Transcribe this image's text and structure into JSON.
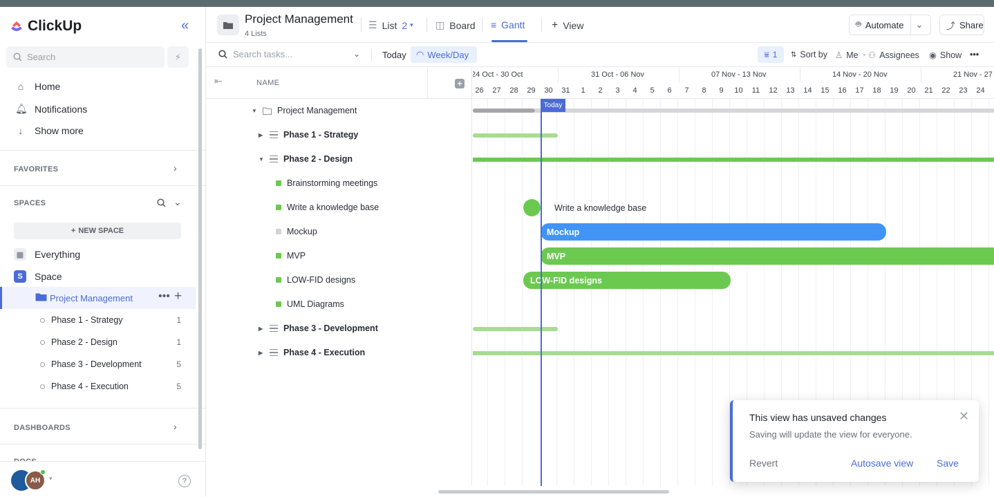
{
  "app": {
    "name": "ClickUp"
  },
  "sidebar": {
    "search_placeholder": "Search",
    "nav": [
      {
        "label": "Home",
        "icon": "home-icon"
      },
      {
        "label": "Notifications",
        "icon": "bell-icon"
      },
      {
        "label": "Show more",
        "icon": "arrow-down-icon"
      }
    ],
    "favorites_label": "FAVORITES",
    "spaces_label": "SPACES",
    "new_space_label": "NEW SPACE",
    "everything_label": "Everything",
    "space_label": "Space",
    "space_initial": "S",
    "folder_label": "Project Management",
    "lists": [
      {
        "label": "Phase 1 - Strategy",
        "count": "1"
      },
      {
        "label": "Phase 2 - Design",
        "count": "1"
      },
      {
        "label": "Phase 3 - Development",
        "count": "5"
      },
      {
        "label": "Phase 4 - Execution",
        "count": "5"
      }
    ],
    "dashboards_label": "DASHBOARDS",
    "docs_label": "DOCS",
    "avatar_initials": "AH"
  },
  "header": {
    "title": "Project Management",
    "subtitle": "4 Lists",
    "tabs": [
      {
        "label": "List",
        "badge": "2"
      },
      {
        "label": "Board"
      },
      {
        "label": "Gantt"
      },
      {
        "label": "View"
      }
    ],
    "automate_label": "Automate",
    "share_label": "Share"
  },
  "toolbar": {
    "search_placeholder": "Search tasks...",
    "today_label": "Today",
    "week_label": "Week/Day",
    "filter_count": "1",
    "sort_label": "Sort by",
    "me_label": "Me",
    "assignees_label": "Assignees",
    "show_label": "Show"
  },
  "tree": {
    "name_header": "NAME",
    "folder": "Project Management",
    "rows": [
      {
        "label": "Phase 1 - Strategy",
        "type": "list",
        "expanded": false
      },
      {
        "label": "Phase 2 - Design",
        "type": "list",
        "expanded": true
      },
      {
        "label": "Brainstorming meetings",
        "type": "task",
        "status_color": "#6bc950"
      },
      {
        "label": "Write a knowledge base",
        "type": "task",
        "status_color": "#6bc950"
      },
      {
        "label": "Mockup",
        "type": "task",
        "status_color": "#d3d3d3"
      },
      {
        "label": "MVP",
        "type": "task",
        "status_color": "#6bc950"
      },
      {
        "label": "LOW-FID designs",
        "type": "task",
        "status_color": "#6bc950"
      },
      {
        "label": "UML Diagrams",
        "type": "task",
        "status_color": "#6bc950"
      },
      {
        "label": "Phase 3 - Development",
        "type": "list",
        "expanded": false
      },
      {
        "label": "Phase 4 - Execution",
        "type": "list",
        "expanded": false
      }
    ]
  },
  "gantt": {
    "weeks": [
      "24 Oct - 30 Oct",
      "31 Oct - 06 Nov",
      "07 Nov - 13 Nov",
      "14 Nov - 20 Nov",
      "21 Nov - 27"
    ],
    "days": [
      "26",
      "27",
      "28",
      "29",
      "30",
      "31",
      "1",
      "2",
      "3",
      "4",
      "5",
      "6",
      "7",
      "8",
      "9",
      "10",
      "11",
      "12",
      "13",
      "14",
      "15",
      "16",
      "17",
      "18",
      "19",
      "20",
      "21",
      "22",
      "23",
      "24"
    ],
    "today_label": "Today",
    "bars": {
      "mockup": "Mockup",
      "mvp": "MVP",
      "lowfid": "LOW-FID designs",
      "milestone": "Write a knowledge base"
    },
    "colors": {
      "accent": "#4b6bd6",
      "green": "#6bc950",
      "light_green": "#a6dd91",
      "blue": "#4194f6",
      "gray": "#c7c7c9"
    }
  },
  "toast": {
    "title": "This view has unsaved changes",
    "message": "Saving will update the view for everyone.",
    "revert": "Revert",
    "autosave": "Autosave view",
    "save": "Save"
  }
}
